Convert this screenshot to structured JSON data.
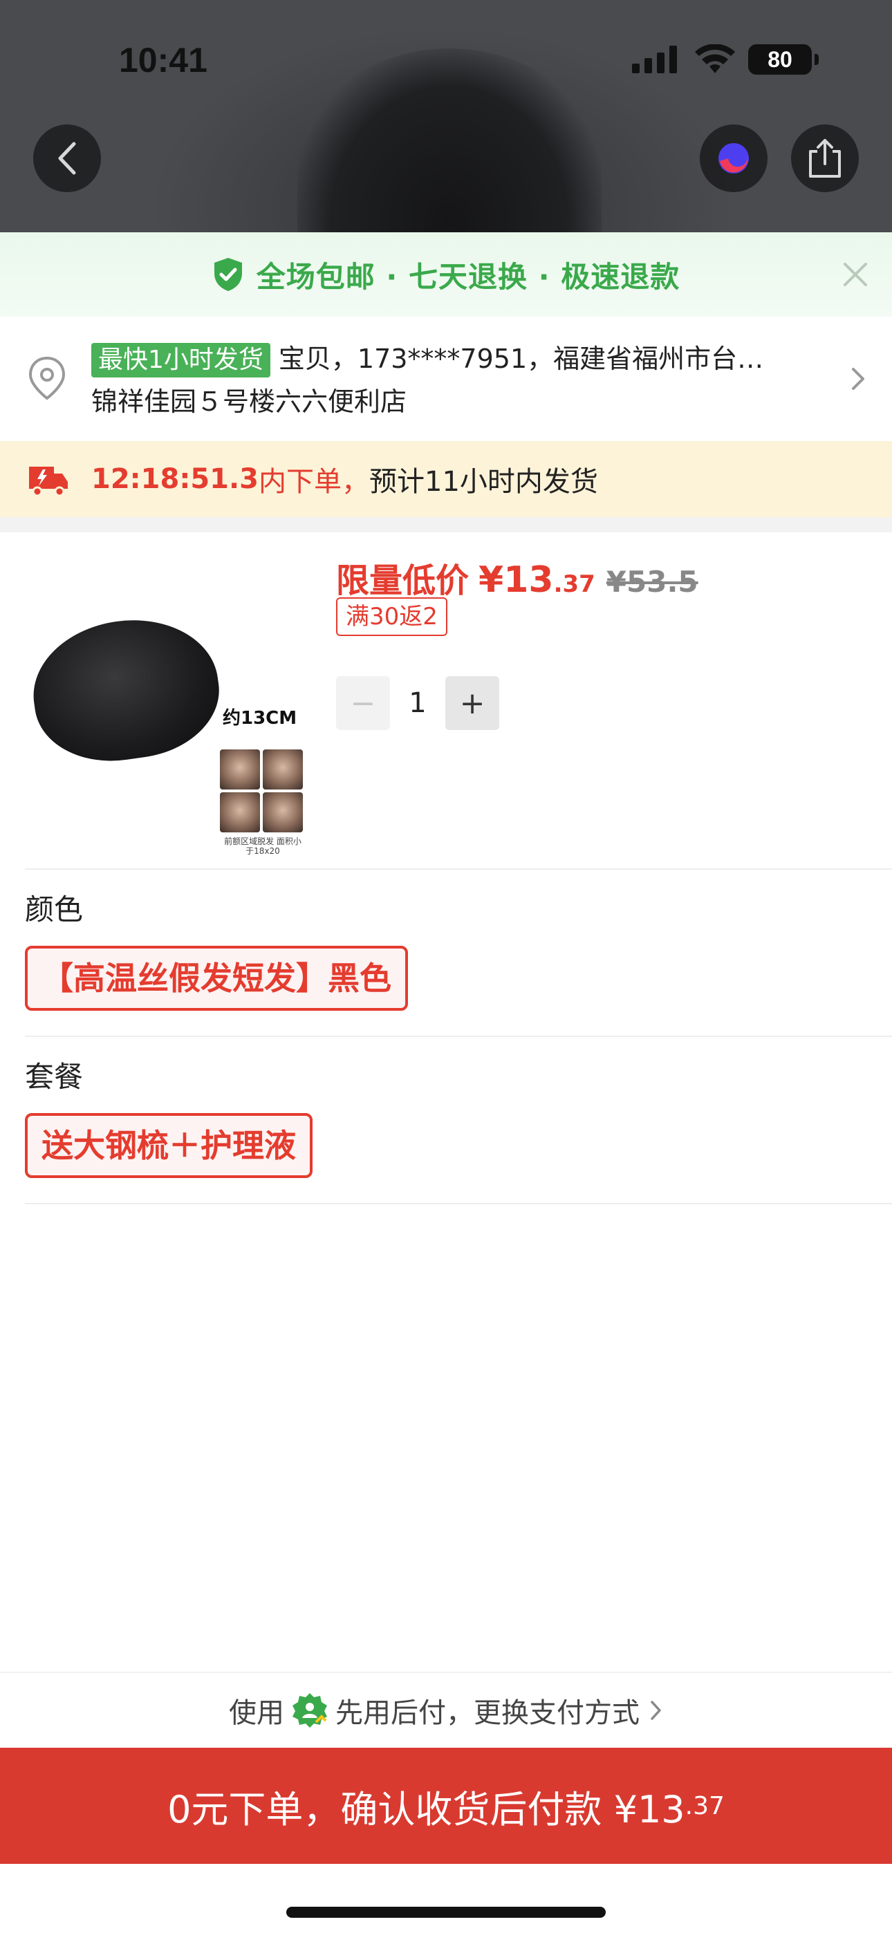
{
  "status_bar": {
    "time": "10:41",
    "battery": "80"
  },
  "promo": {
    "text": "全场包邮 · 七天退换 · 极速退款"
  },
  "address": {
    "tag": "最快1小时发货",
    "line1": "宝贝，173****7951，福建省福州市台…",
    "line2": "锦祥佳园５号楼六六便利店"
  },
  "delivery": {
    "countdown": "12:18:51.3",
    "order_label": "内下单，",
    "estimate": "预计11小时内发货"
  },
  "product": {
    "image_size_label": "约13CM",
    "image_caption": "前额区域脱发 面积小于18x20",
    "price_label": "限量低价",
    "price_main": "¥13",
    "price_decimal": ".37",
    "price_original": "¥53.5",
    "coupon": "满30返2",
    "quantity": "1",
    "minus_symbol": "−",
    "plus_symbol": "+"
  },
  "options": {
    "color_title": "颜色",
    "color_value": "【高温丝假发短发】黑色",
    "package_title": "套餐",
    "package_value": "送大钢梳＋护理液"
  },
  "payment": {
    "prefix": "使用",
    "method": "先用后付，更换支付方式"
  },
  "cta": {
    "label": "0元下单，确认收货后付款 ¥13",
    "decimal": ".37"
  },
  "colors": {
    "accent_red": "#e43c2f",
    "promo_green": "#3aa94b",
    "cta_red": "#d93a30",
    "delivery_bg": "#fcf3d8"
  }
}
